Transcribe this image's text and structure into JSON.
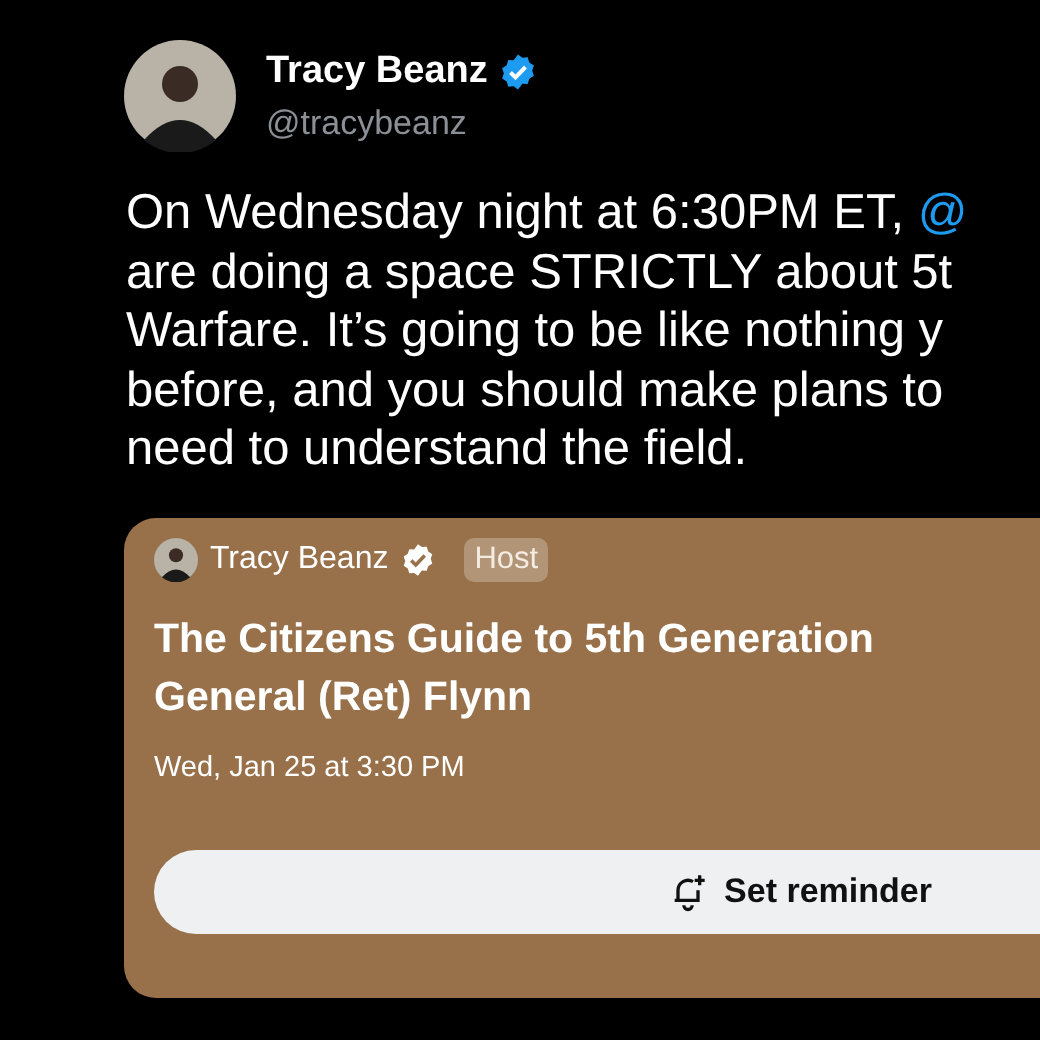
{
  "author": {
    "name": "Tracy Beanz",
    "verified": true,
    "handle": "@tracybeanz"
  },
  "tweet_lines": [
    {
      "text": "On Wednesday night at 6:30PM ET, ",
      "mention": "@"
    },
    {
      "text": "are doing a space STRICTLY about 5t"
    },
    {
      "text": "Warfare. It’s going to be like nothing y"
    },
    {
      "text": "before, and you should make plans to"
    },
    {
      "text": "need to understand the field."
    }
  ],
  "space_card": {
    "host_name": "Tracy Beanz",
    "verified": true,
    "role_badge": "Host",
    "title_lines": [
      "The Citizens Guide to 5th Generation",
      "General (Ret) Flynn"
    ],
    "date": "Wed, Jan 25 at 3:30 PM",
    "button": "Set reminder"
  }
}
